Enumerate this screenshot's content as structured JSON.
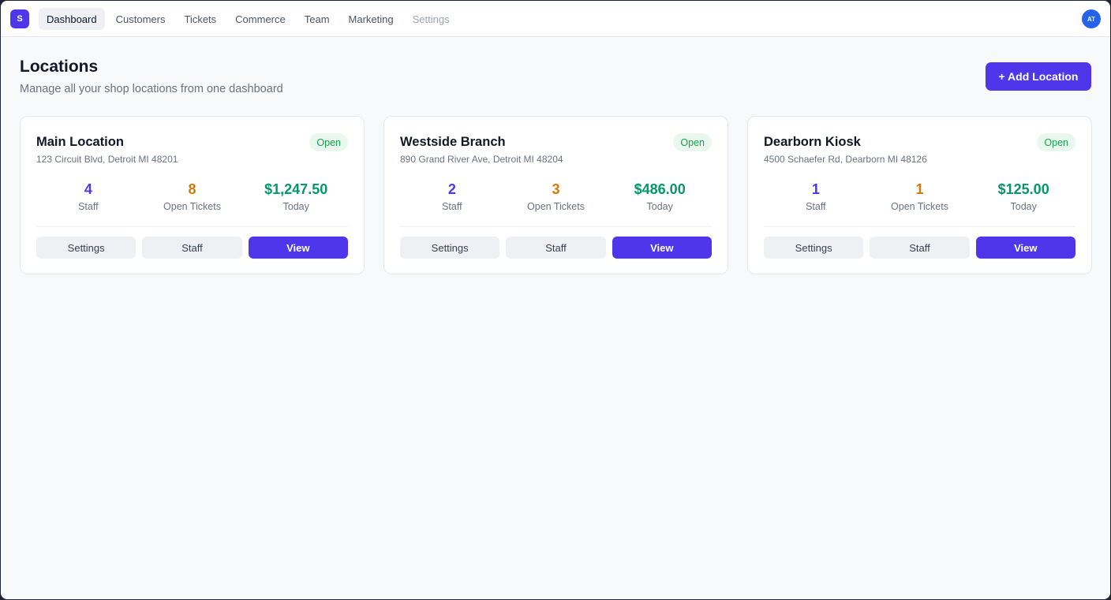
{
  "app": {
    "logo_letter": "S",
    "avatar_initials": "AT"
  },
  "nav": {
    "items": [
      {
        "label": "Dashboard",
        "state": "active"
      },
      {
        "label": "Customers",
        "state": "normal"
      },
      {
        "label": "Tickets",
        "state": "normal"
      },
      {
        "label": "Commerce",
        "state": "normal"
      },
      {
        "label": "Team",
        "state": "normal"
      },
      {
        "label": "Marketing",
        "state": "normal"
      },
      {
        "label": "Settings",
        "state": "muted"
      }
    ]
  },
  "header": {
    "title": "Locations",
    "subtitle": "Manage all your shop locations from one dashboard",
    "add_button": "+ Add Location"
  },
  "labels": {
    "staff": "Staff",
    "open_tickets": "Open Tickets",
    "today": "Today"
  },
  "actions": {
    "settings": "Settings",
    "staff": "Staff",
    "view": "View"
  },
  "locations": [
    {
      "name": "Main Location",
      "address": "123 Circuit Blvd, Detroit MI 48201",
      "status": "Open",
      "staff": "4",
      "open_tickets": "8",
      "today": "$1,247.50"
    },
    {
      "name": "Westside Branch",
      "address": "890 Grand River Ave, Detroit MI 48204",
      "status": "Open",
      "staff": "2",
      "open_tickets": "3",
      "today": "$486.00"
    },
    {
      "name": "Dearborn Kiosk",
      "address": "4500 Schaefer Rd, Dearborn MI 48126",
      "status": "Open",
      "staff": "1",
      "open_tickets": "1",
      "today": "$125.00"
    }
  ],
  "colors": {
    "accent": "#4f36ea",
    "open_badge": "#16a34a",
    "tickets": "#d97706",
    "revenue": "#059669"
  }
}
